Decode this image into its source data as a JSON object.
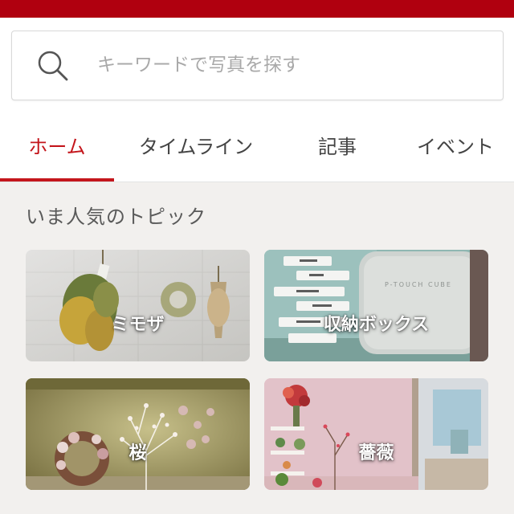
{
  "search": {
    "placeholder": "キーワードで写真を探す"
  },
  "tabs": [
    {
      "label": "ホーム",
      "active": true
    },
    {
      "label": "タイムライン",
      "active": false
    },
    {
      "label": "記事",
      "active": false
    },
    {
      "label": "イベント",
      "active": false
    }
  ],
  "section": {
    "title": "いま人気のトピック"
  },
  "topics": [
    {
      "label": "ミモザ"
    },
    {
      "label": "収納ボックス"
    },
    {
      "label": "桜"
    },
    {
      "label": "薔薇"
    }
  ],
  "colors": {
    "brand": "#b0000f",
    "accent": "#c4161c"
  }
}
